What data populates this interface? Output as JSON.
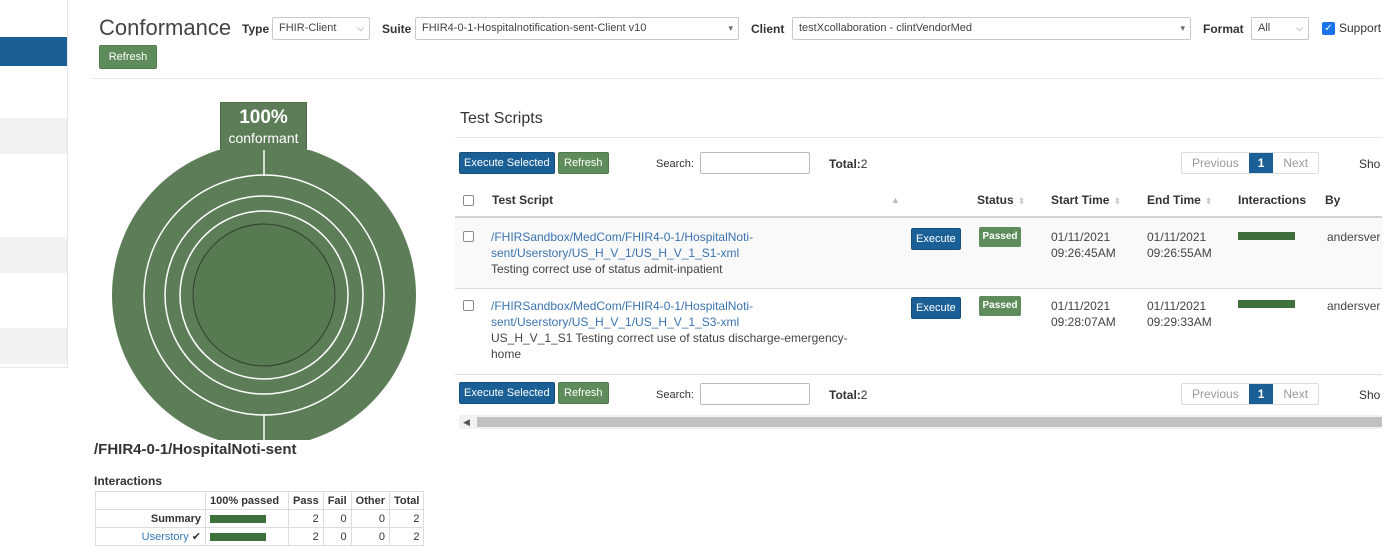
{
  "header": {
    "title": "Conformance",
    "type_label": "Type",
    "type_value": "FHIR-Client",
    "suite_label": "Suite",
    "suite_value": "FHIR4-0-1-Hospitalnotification-sent-Client v10",
    "client_label": "Client",
    "client_value": "testXcollaboration - clintVendorMed",
    "format_label": "Format",
    "format_value": "All",
    "support_label": "Support",
    "refresh_label": "Refresh"
  },
  "summary": {
    "percent": "100%",
    "percent_label": "conformant",
    "suite_name": "/FHIR4-0-1/HospitalNoti-sent",
    "interactions_title": "Interactions",
    "columns": [
      "100% passed",
      "Pass",
      "Fail",
      "Other",
      "Total"
    ],
    "rows": [
      {
        "label": "Summary",
        "pass": "2",
        "fail": "0",
        "other": "0",
        "total": "2"
      },
      {
        "label": "Userstory",
        "check": "✔",
        "pass": "2",
        "fail": "0",
        "other": "0",
        "total": "2"
      }
    ]
  },
  "test_scripts": {
    "title": "Test Scripts",
    "execute_selected_label": "Execute Selected",
    "refresh_label": "Refresh",
    "search_label": "Search:",
    "total_label": "Total:",
    "total_value": "2",
    "pager": {
      "previous": "Previous",
      "current": "1",
      "next": "Next"
    },
    "show_label": "Sho",
    "columns": {
      "test_script": "Test Script",
      "status": "Status",
      "start_time": "Start Time",
      "end_time": "End Time",
      "interactions": "Interactions",
      "by": "By"
    },
    "rows": [
      {
        "link_line1": "/FHIRSandbox/MedCom/FHIR4-0-1/HospitalNoti-",
        "link_line2": "sent/Userstory/US_H_V_1/US_H_V_1_S1-xml",
        "description": "Testing correct use of status admit-inpatient",
        "execute_label": "Execute",
        "status": "Passed",
        "start_date": "01/11/2021",
        "start_time": "09:26:45AM",
        "end_date": "01/11/2021",
        "end_time": "09:26:55AM",
        "by": "andersver"
      },
      {
        "link_line1": "/FHIRSandbox/MedCom/FHIR4-0-1/HospitalNoti-",
        "link_line2": "sent/Userstory/US_H_V_1/US_H_V_1_S3-xml",
        "description_line1": "US_H_V_1_S1 Testing correct use of status discharge-emergency-",
        "description_line2": "home",
        "execute_label": "Execute",
        "status": "Passed",
        "start_date": "01/11/2021",
        "start_time": "09:28:07AM",
        "end_date": "01/11/2021",
        "end_time": "09:29:33AM",
        "by": "andersver"
      }
    ]
  },
  "colors": {
    "primary_blue": "#1a5f96",
    "success_green": "#5e8c5a",
    "donut_green": "#5d7d58",
    "bar_green": "#3f6f3b",
    "link_blue": "#3a73b0"
  }
}
